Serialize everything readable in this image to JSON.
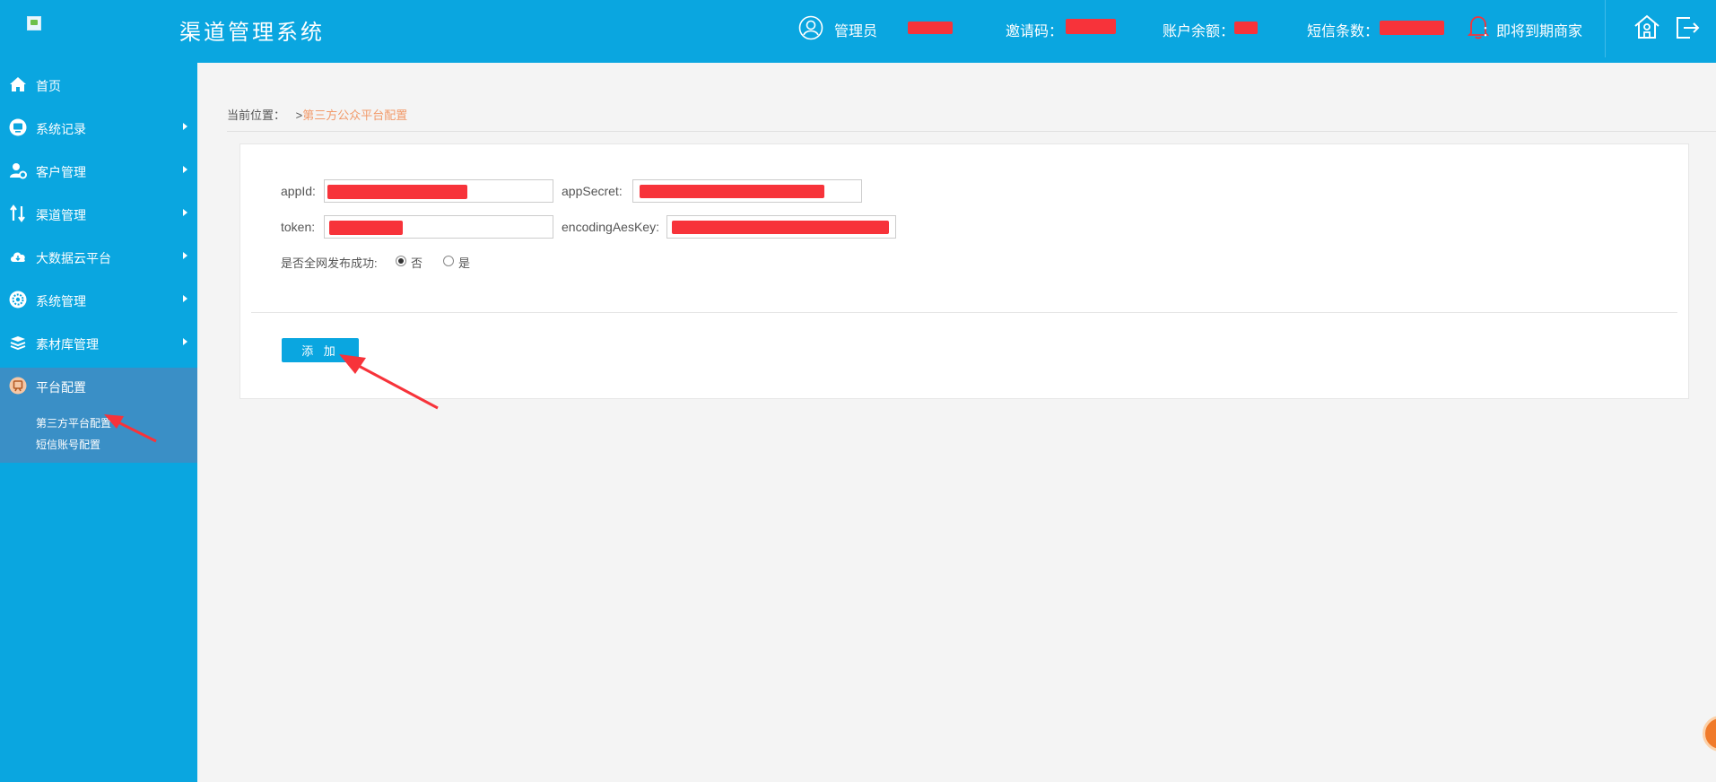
{
  "header": {
    "title": "渠道管理系统",
    "role": "管理员",
    "invite_label": "邀请码：",
    "balance_label": "账户余额：",
    "sms_label": "短信条数：",
    "notice": "：即将到期商家"
  },
  "sidebar": {
    "items": [
      {
        "label": "首页",
        "icon": "home-icon"
      },
      {
        "label": "系统记录",
        "icon": "monitor-icon"
      },
      {
        "label": "客户管理",
        "icon": "user-gear-icon"
      },
      {
        "label": "渠道管理",
        "icon": "swap-icon"
      },
      {
        "label": "大数据云平台",
        "icon": "cloud-icon"
      },
      {
        "label": "系统管理",
        "icon": "settings-icon"
      },
      {
        "label": "素材库管理",
        "icon": "layers-icon"
      },
      {
        "label": "平台配置",
        "icon": "platform-icon"
      }
    ],
    "sub_items": [
      "第三方平台配置",
      "短信账号配置"
    ]
  },
  "breadcrumb": {
    "prefix": "当前位置：",
    "sep": ">",
    "current": "第三方公众平台配置"
  },
  "form": {
    "appid_label": "appId:",
    "appsecret_label": "appSecret:",
    "token_label": "token:",
    "aeskey_label": "encodingAesKey:",
    "publish_label": "是否全网发布成功:",
    "option_no": "否",
    "option_yes": "是",
    "add_button": "添 加"
  },
  "colors": {
    "primary": "#0aa6e0",
    "active_group": "#3a8fc6",
    "breadcrumb_current": "#f29a6a",
    "redaction": "#f7333a"
  }
}
